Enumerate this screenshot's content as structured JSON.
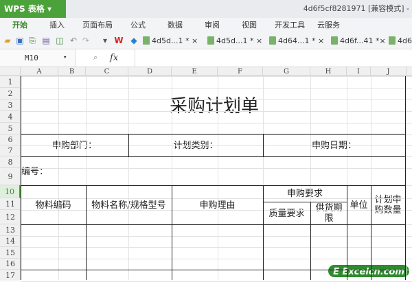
{
  "app": {
    "name": "WPS 表格",
    "doc_title": "4d6f5cf8281971 [兼容模式] -"
  },
  "menu": [
    "开始",
    "插入",
    "页面布局",
    "公式",
    "数据",
    "审阅",
    "视图",
    "开发工具",
    "云服务"
  ],
  "doc_tabs": [
    "4d5d...1 * ×",
    "4d5d...1 * ×",
    "4d64...1 * ×",
    "4d6f...41 *×",
    "4d6"
  ],
  "formula_bar": {
    "name_box": "M10",
    "fx": "fx",
    "value": ""
  },
  "columns": [
    "A",
    "B",
    "C",
    "D",
    "E",
    "F",
    "G",
    "H",
    "I",
    "J"
  ],
  "rows": [
    "1",
    "2",
    "3",
    "4",
    "5",
    "6",
    "7",
    "8",
    "9",
    "10",
    "11",
    "12",
    "13",
    "14",
    "15",
    "16",
    "17"
  ],
  "sheet": {
    "title": "采购计划单",
    "dept": "申购部门：",
    "plan_type": "计划类别：",
    "date": "申购日期：",
    "number": "编号：",
    "headers": {
      "code": "物料编码",
      "name": "物料名称/规格型号",
      "reason": "申购理由",
      "req": "申购要求",
      "quality": "质量要求",
      "supply": "供货期限",
      "unit": "单位",
      "qty": "计划申购数量"
    }
  },
  "watermark": "Excelcn.com",
  "colors": {
    "accent": "#4ca23a"
  }
}
